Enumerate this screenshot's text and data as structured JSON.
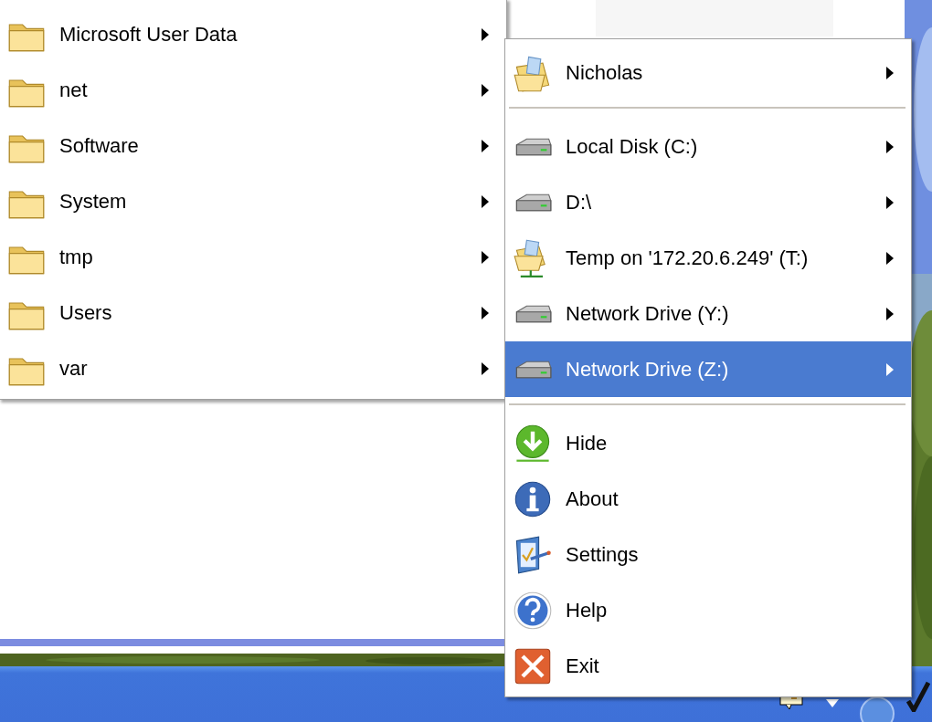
{
  "folder_menu": {
    "items": [
      {
        "label": "Microsoft User Data",
        "kind": "folder",
        "has_submenu": true,
        "selected": false
      },
      {
        "label": "net",
        "kind": "folder",
        "has_submenu": true,
        "selected": false
      },
      {
        "label": "Software",
        "kind": "folder",
        "has_submenu": true,
        "selected": false
      },
      {
        "label": "System",
        "kind": "folder",
        "has_submenu": true,
        "selected": false
      },
      {
        "label": "tmp",
        "kind": "folder",
        "has_submenu": true,
        "selected": false
      },
      {
        "label": "Users",
        "kind": "folder",
        "has_submenu": true,
        "selected": false
      },
      {
        "label": "var",
        "kind": "folder",
        "has_submenu": true,
        "selected": false
      }
    ]
  },
  "tray_menu": {
    "sections": [
      {
        "items": [
          {
            "label": "Nicholas",
            "kind": "user-folder",
            "has_submenu": true,
            "selected": false
          }
        ]
      },
      {
        "items": [
          {
            "label": "Local Disk (C:)",
            "kind": "drive",
            "has_submenu": true,
            "selected": false
          },
          {
            "label": "D:\\",
            "kind": "drive",
            "has_submenu": true,
            "selected": false
          },
          {
            "label": "Temp on '172.20.6.249' (T:)",
            "kind": "network-share",
            "has_submenu": true,
            "selected": false
          },
          {
            "label": "Network Drive (Y:)",
            "kind": "drive",
            "has_submenu": true,
            "selected": false
          },
          {
            "label": "Network Drive (Z:)",
            "kind": "drive",
            "has_submenu": true,
            "selected": true
          }
        ]
      },
      {
        "items": [
          {
            "label": "Hide",
            "kind": "hide",
            "has_submenu": false,
            "selected": false
          },
          {
            "label": "About",
            "kind": "about",
            "has_submenu": false,
            "selected": false
          },
          {
            "label": "Settings",
            "kind": "settings",
            "has_submenu": false,
            "selected": false
          },
          {
            "label": "Help",
            "kind": "help",
            "has_submenu": false,
            "selected": false
          },
          {
            "label": "Exit",
            "kind": "exit",
            "has_submenu": false,
            "selected": false
          }
        ]
      }
    ]
  }
}
